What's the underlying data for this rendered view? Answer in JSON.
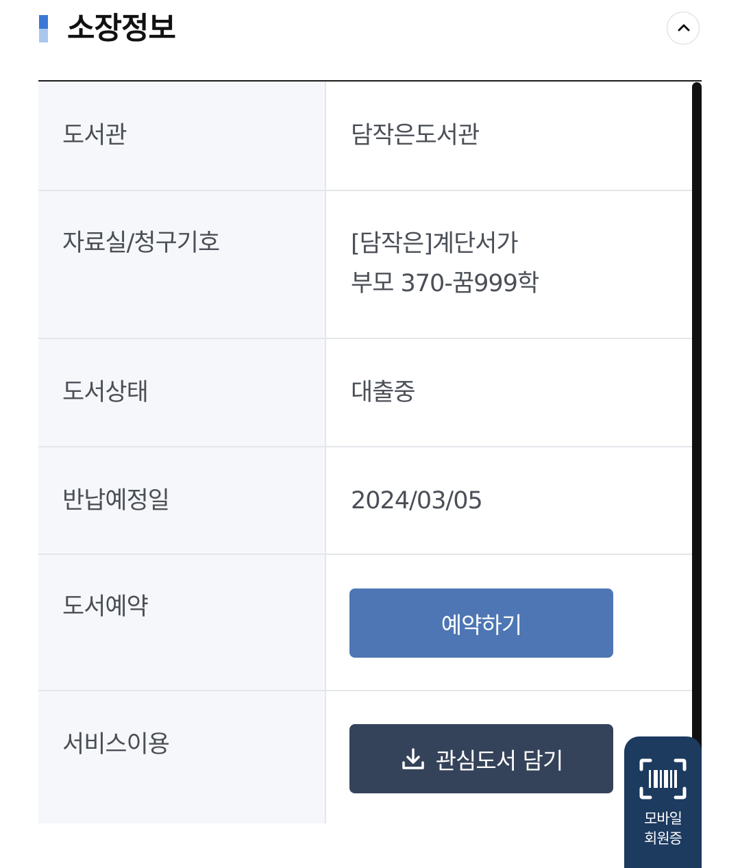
{
  "section": {
    "title": "소장정보",
    "collapse_icon": "chevron-up-icon"
  },
  "rows": {
    "library": {
      "label": "도서관",
      "value": "담작은도서관"
    },
    "location": {
      "label": "자료실/청구기호",
      "value_line1": "[담작은]계단서가",
      "value_line2": "부모 370-꿈999학"
    },
    "status": {
      "label": "도서상태",
      "value": "대출중"
    },
    "due_date": {
      "label": "반납예정일",
      "value": "2024/03/05"
    },
    "reservation": {
      "label": "도서예약",
      "button": "예약하기"
    },
    "service": {
      "label": "서비스이용",
      "button": "관심도서 담기",
      "button_icon": "download-icon"
    }
  },
  "mobile_card": {
    "line1": "모바일",
    "line2": "회원증",
    "icon": "barcode-scan-icon"
  },
  "colors": {
    "accent": "#3a78d6",
    "reserve_button": "#4e76b4",
    "interest_button": "#344359",
    "mobile_card": "#1d3a5f"
  }
}
